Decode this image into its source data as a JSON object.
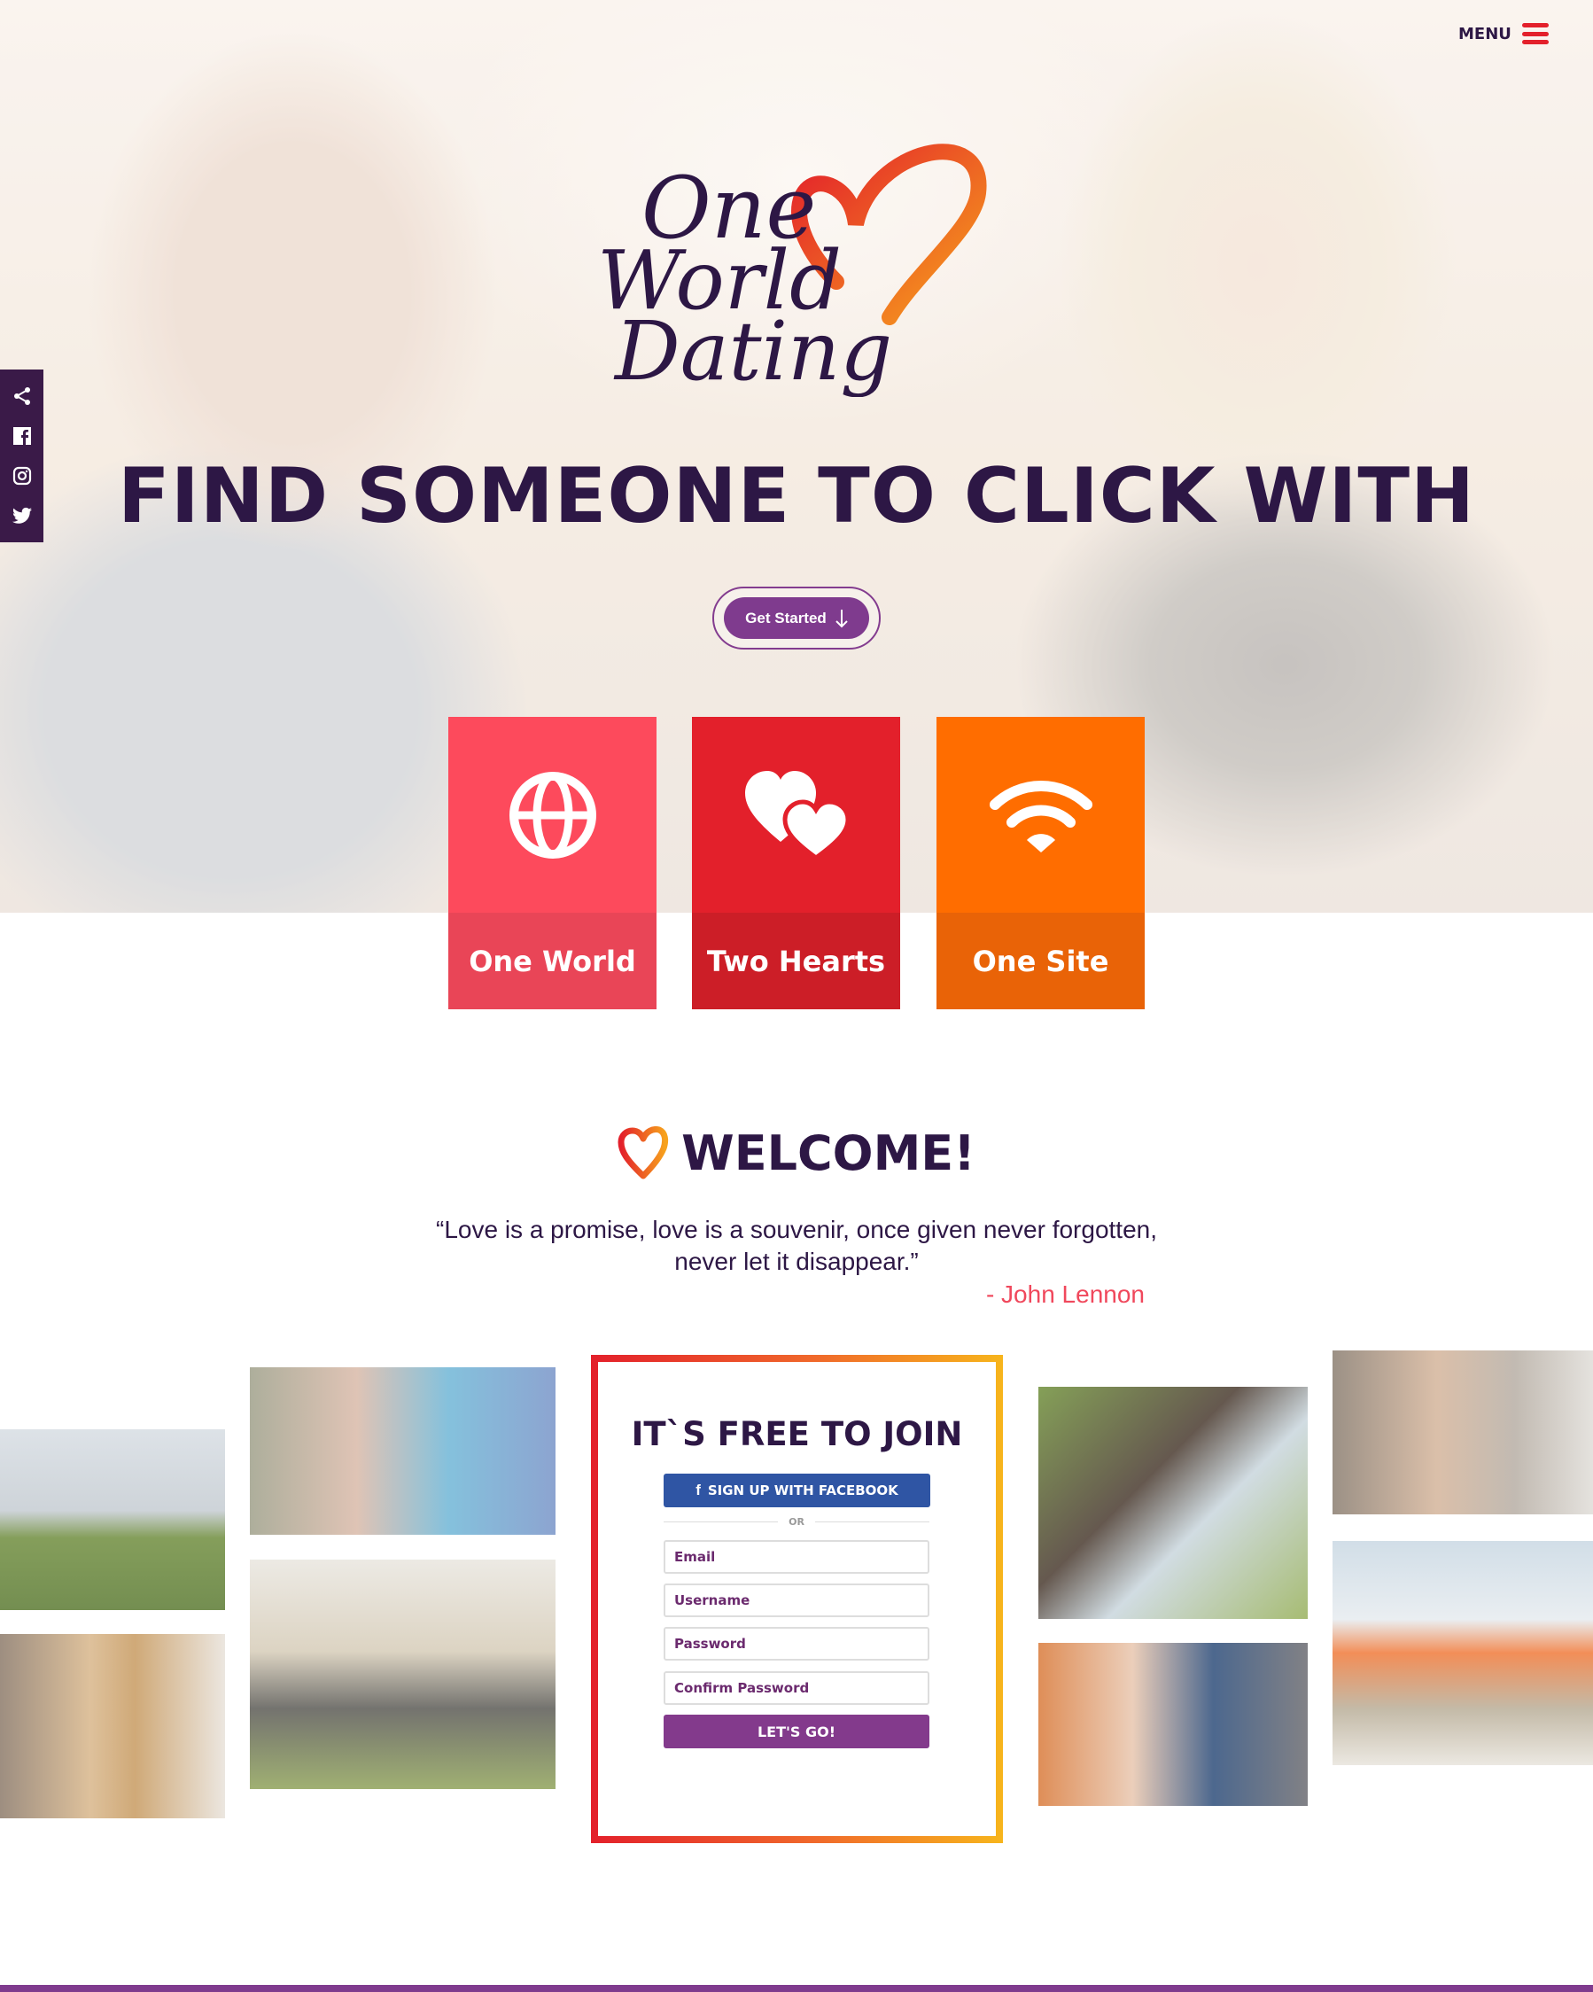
{
  "header": {
    "menu_label": "MENU"
  },
  "social": [
    "share-icon",
    "facebook-icon",
    "instagram-icon",
    "twitter-icon"
  ],
  "logo": {
    "text": "One World Dating"
  },
  "hero": {
    "headline": "FIND SOMEONE TO CLICK WITH",
    "cta_label": "Get Started"
  },
  "tiles": [
    {
      "label": "One World",
      "icon": "globe-icon",
      "color": "#fd4a5c",
      "label_bg": "#e94557"
    },
    {
      "label": "Two Hearts",
      "icon": "hearts-icon",
      "color": "#e3202b",
      "label_bg": "#cc1e27"
    },
    {
      "label": "One Site",
      "icon": "wifi-icon",
      "color": "#ff6d00",
      "label_bg": "#e96307"
    }
  ],
  "welcome": {
    "title": "WELCOME!",
    "quote_line1": "“Love is a promise, love is a souvenir, once given never forgotten,",
    "quote_line2": "never let it disappear.”",
    "author": "- John Lennon"
  },
  "form": {
    "title": "IT`S FREE TO JOIN",
    "facebook_label": "SIGN UP WITH FACEBOOK",
    "or_label": "OR",
    "email_placeholder": "Email",
    "username_placeholder": "Username",
    "password_placeholder": "Password",
    "confirm_placeholder": "Confirm Password",
    "submit_label": "LET'S GO!"
  },
  "colors": {
    "primary": "#2d1745",
    "accent": "#7f3b8e",
    "red": "#e3202b",
    "facebook": "#2f55a4"
  }
}
